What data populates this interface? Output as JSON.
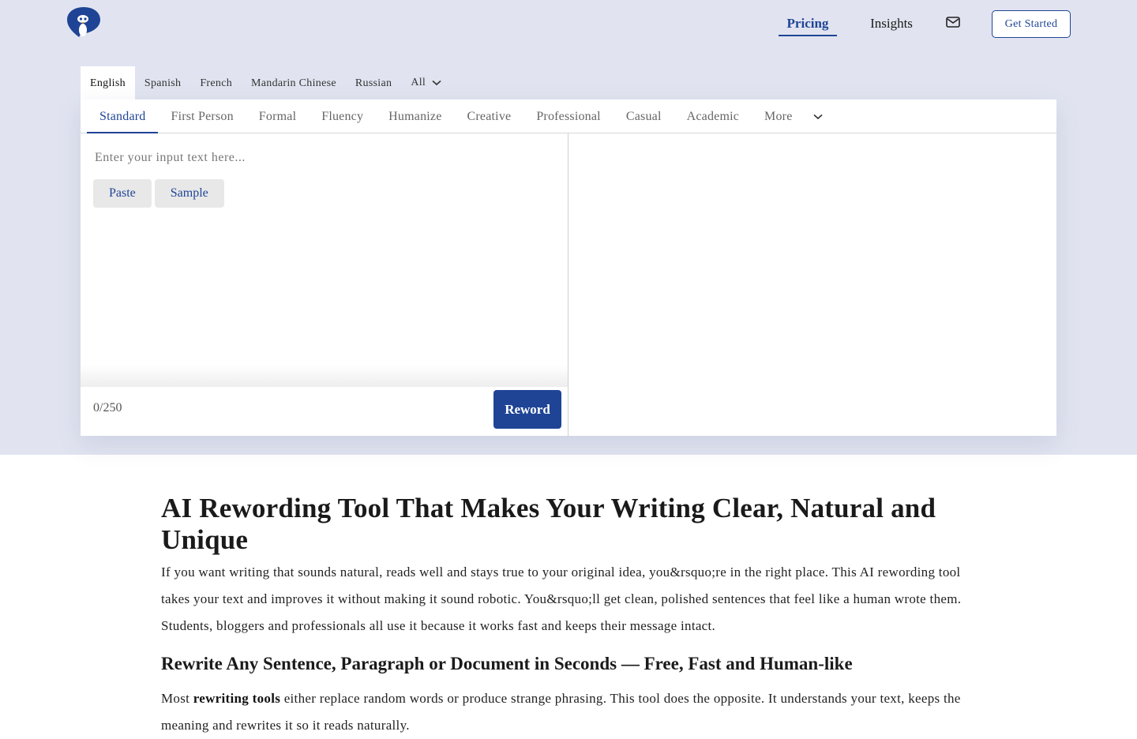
{
  "header": {
    "nav_pricing": "Pricing",
    "nav_insights": "Insights",
    "get_started": "Get Started"
  },
  "languages": [
    "English",
    "Spanish",
    "French",
    "Mandarin Chinese",
    "Russian",
    "All"
  ],
  "active_language": "English",
  "modes": [
    "Standard",
    "First Person",
    "Formal",
    "Fluency",
    "Humanize",
    "Creative",
    "Professional",
    "Casual",
    "Academic",
    "More"
  ],
  "active_mode": "Standard",
  "editor": {
    "placeholder": "Enter your input text here...",
    "paste": "Paste",
    "sample": "Sample",
    "counter": "0/250",
    "reword": "Reword"
  },
  "article": {
    "title": "AI Rewording Tool That Makes Your Writing Clear, Natural and Unique",
    "intro": "If you want writing that sounds natural, reads well and stays true to your original idea, you&rsquo;re in the right place. This AI rewording tool takes your text and improves it without making it sound robotic. You&rsquo;ll get clean, polished sentences that feel like a human wrote them. Students, bloggers and professionals all use it because it works fast and keeps their message intact.",
    "subtitle": "Rewrite Any Sentence, Paragraph or Document in Seconds — Free, Fast and Human-like",
    "p2_prefix": "Most ",
    "p2_bold": "rewriting tools",
    "p2_rest": " either replace random words or produce strange phrasing. This tool does the opposite. It understands your text, keeps the meaning and rewrites it so it reads naturally."
  },
  "colors": {
    "brand": "#1f4496",
    "hero_bg": "#e1e4f0"
  },
  "icons": {
    "logo": "penguin-logo-icon",
    "mail": "mail-icon",
    "chevron": "chevron-down-icon"
  }
}
